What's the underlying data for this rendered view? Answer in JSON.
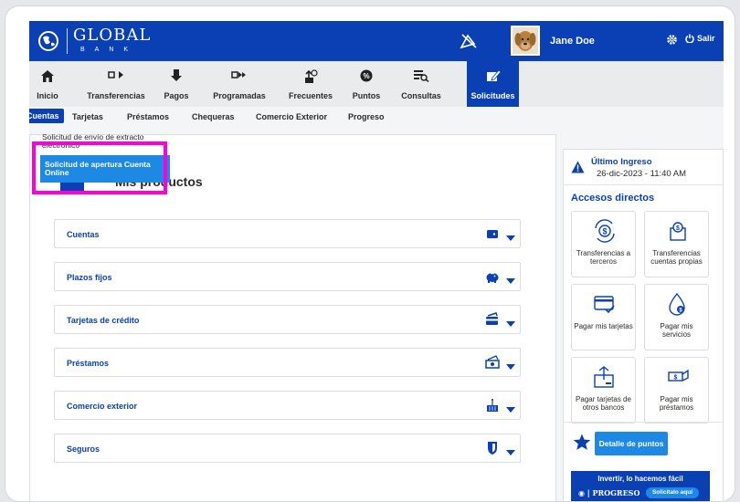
{
  "brand": {
    "name": "GLOBAL",
    "sub": "BANK"
  },
  "user": {
    "name": "Jane Doe",
    "logout_label": "Salir"
  },
  "nav": {
    "items": [
      {
        "label": "Inicio",
        "icon": "home-icon"
      },
      {
        "label": "Transferencias",
        "icon": "transfer-icon"
      },
      {
        "label": "Pagos",
        "icon": "payments-icon"
      },
      {
        "label": "Programadas",
        "icon": "scheduled-icon"
      },
      {
        "label": "Frecuentes",
        "icon": "frequent-icon"
      },
      {
        "label": "Puntos",
        "icon": "points-icon"
      },
      {
        "label": "Consultas",
        "icon": "queries-icon"
      },
      {
        "label": "Solicitudes",
        "icon": "requests-icon"
      }
    ],
    "active": "Solicitudes"
  },
  "subnav": {
    "items": [
      "Cuentas",
      "Tarjetas",
      "Préstamos",
      "Chequeras",
      "Comercio Exterior",
      "Progreso"
    ],
    "active": "Cuentas"
  },
  "dropdown": {
    "item1": "Solicitud de envío de extracto electrónico",
    "item2": "Solicitud de apertura Cuenta Online"
  },
  "main": {
    "title": "Mis productos",
    "products": [
      {
        "label": "Cuentas",
        "icon": "wallet-icon"
      },
      {
        "label": "Plazos fijos",
        "icon": "piggy-bank-icon"
      },
      {
        "label": "Tarjetas de crédito",
        "icon": "credit-card-icon"
      },
      {
        "label": "Préstamos",
        "icon": "money-bill-icon"
      },
      {
        "label": "Comercio exterior",
        "icon": "cargo-icon"
      },
      {
        "label": "Seguros",
        "icon": "shield-icon"
      }
    ]
  },
  "sidebar": {
    "last_login_title": "Último Ingreso",
    "last_login_date": "26-dic-2023 - 11:40 AM",
    "quick_title": "Accesos directos",
    "tiles": [
      "Transferencias a terceros",
      "Transferencias cuentas propias",
      "Pagar mis tarjetas",
      "Pagar mis servicios",
      "Pagar tarjetas de otros bancos",
      "Pagar mis préstamos"
    ],
    "points_button": "Detalle de puntos",
    "banner": {
      "tagline": "Invertir, lo hacemos fácil",
      "logo": "PROGRESO",
      "cta": "Solicítalo aquí"
    }
  },
  "colors": {
    "primary": "#0a40b3",
    "accent": "#1e88e5",
    "highlight": "#ff00dd"
  }
}
